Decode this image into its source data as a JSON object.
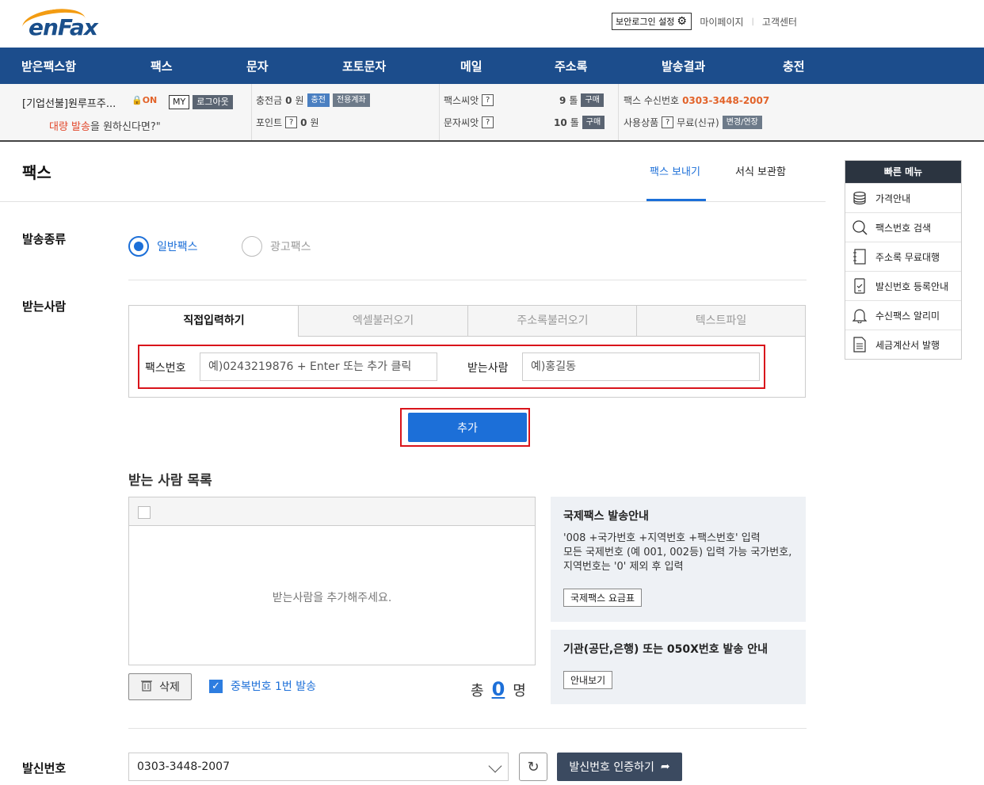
{
  "header": {
    "logo": "enFax",
    "secure_login": "보안로그인 설정",
    "mypage": "마이페이지",
    "support": "고객센터"
  },
  "nav": [
    "받은팩스함",
    "팩스",
    "문자",
    "포토문자",
    "메일",
    "주소록",
    "발송결과",
    "충전"
  ],
  "account": {
    "name": "[기업선불]원루프주...",
    "on_label": "ON",
    "my_btn": "MY",
    "logout_btn": "로그아웃",
    "promo_red": "대량 발송",
    "promo_rest": "을 원하신다면?\"",
    "charge_label": "충전금",
    "charge_value": "0",
    "won": "원",
    "charge_btn": "충전",
    "account_btn": "전용계좌",
    "point_label": "포인트",
    "point_value": "0",
    "q": "?",
    "fax_credit_label": "팩스씨앗",
    "fax_credit_value": "9",
    "sms_credit_label": "문자씨앗",
    "sms_credit_value": "10",
    "unit": "톨",
    "buy_btn": "구매",
    "fax_number_label": "팩스 수신번호",
    "fax_number": "0303-3448-2007",
    "product_label": "사용상품",
    "product_value": "무료(신규)",
    "change_btn": "변경/연장"
  },
  "page": {
    "title": "팩스",
    "tab_send": "팩스 보내기",
    "tab_form": "서식 보관함"
  },
  "quick_menu": {
    "title": "빠른 메뉴",
    "items": [
      "가격안내",
      "팩스번호 검색",
      "주소록 무료대행",
      "발신번호 등록안내",
      "수신팩스 알리미",
      "세금계산서 발행"
    ]
  },
  "form": {
    "send_type_label": "발송종류",
    "type_normal": "일반팩스",
    "type_ad": "광고팩스",
    "recipient_label": "받는사람",
    "tabs": [
      "직접입력하기",
      "엑셀불러오기",
      "주소록불러오기",
      "텍스트파일"
    ],
    "fax_label": "팩스번호",
    "fax_placeholder": "예)0243219876 + Enter 또는 추가 클릭",
    "name_label": "받는사람",
    "name_placeholder": "예)홍길동",
    "add_btn": "추가",
    "list_title": "받는 사람 목록",
    "list_empty": "받는사람을 추가해주세요.",
    "delete_btn": "삭제",
    "dup_label": "중복번호 1번 발송",
    "total_prefix": "총",
    "total_count": "0",
    "total_suffix": "명",
    "sender_label": "발신번호",
    "sender_value": "0303-3448-2007",
    "verify_btn": "발신번호 인증하기"
  },
  "intl_info": {
    "title": "국제팩스 발송안내",
    "line1": "'008 +국가번호 +지역번호 +팩스번호' 입력",
    "line2": "모든 국제번호 (예 001, 002등) 입력 가능 국가번호, 지역번호는 '0' 제외 후 입력",
    "btn": "국제팩스 요금표"
  },
  "inst_info": {
    "title": "기관(공단,은행) 또는 050X번호 발송 안내",
    "btn": "안내보기"
  }
}
